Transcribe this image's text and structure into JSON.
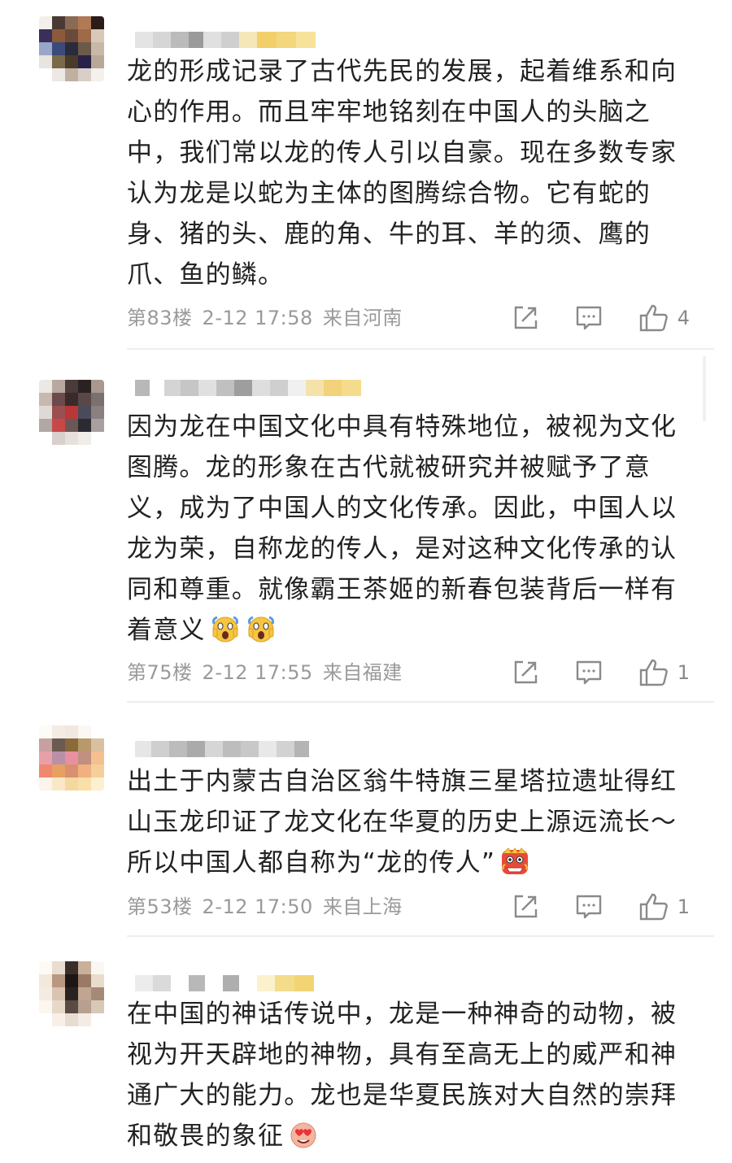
{
  "comments": [
    {
      "text": "龙的形成记录了古代先民的发展，起着维系和向心的作用。而且牢牢地铭刻在中国人的头脑之中，我们常以龙的传人引以自豪。现在多数专家认为龙是以蛇为主体的图腾综合物。它有蛇的身、猪的头、鹿的角、牛的耳、羊的须、鹰的爪、鱼的鳞。",
      "floor": "第83楼",
      "time": "2-12 17:58",
      "location": "来自河南",
      "likes": "4",
      "avatar_colors": [
        "#f3efea",
        "#4a3a33",
        "#8b6a55",
        "#b07a55",
        "#2a1c18",
        "#3a2f5a",
        "#8a5a3a",
        "#6a4a3a",
        "#a06a48",
        "#d8c8b8",
        "#9aa6c8",
        "#3a4a7a",
        "#2a2a3a",
        "#6a5a4a",
        "#c8b8a8",
        "#e8e4e0",
        "#7a6a4a",
        "#4a3a2a",
        "#28224a",
        "#b8a898",
        "#ffffff",
        "#ece8e4",
        "#c0b0a0",
        "#d8d0c8",
        "#f4f0ec"
      ],
      "name_blocks": [
        {
          "w": 22,
          "c": "#e4e4e4"
        },
        {
          "w": 22,
          "c": "#d6d6d6"
        },
        {
          "w": 22,
          "c": "#bbbbbb"
        },
        {
          "w": 18,
          "c": "#9a9a9a"
        },
        {
          "w": 22,
          "c": "#e0e0e0"
        },
        {
          "w": 22,
          "c": "#cfcfcf"
        },
        {
          "w": 22,
          "c": "#f6e7b8"
        },
        {
          "w": 24,
          "c": "#f2cf6a"
        },
        {
          "w": 24,
          "c": "#f4d67c"
        },
        {
          "w": 24,
          "c": "#f6e29a"
        }
      ]
    },
    {
      "text": "因为龙在中国文化中具有特殊地位，被视为文化图腾。龙的形象在古代就被研究并被赋予了意义，成为了中国人的文化传承。因此，中国人以龙为荣，自称龙的传人，是对这种文化传承的认同和尊重。就像霸王茶姬的新春包装背后一样有着意义",
      "floor": "第75楼",
      "time": "2-12 17:55",
      "location": "来自福建",
      "likes": "1",
      "emojis": [
        "scream-emoji",
        "scream-emoji"
      ],
      "avatar_colors": [
        "#ece8e4",
        "#b8a8a0",
        "#4a3a3a",
        "#2a2222",
        "#a89890",
        "#c8b8b0",
        "#6a4a4a",
        "#3a2a2a",
        "#5a4848",
        "#7a7070",
        "#e0d8d4",
        "#9a5050",
        "#b83838",
        "#4a4a5a",
        "#8a8080",
        "#b0a8a4",
        "#c84848",
        "#6a5858",
        "#2a2a30",
        "#a8a0a0",
        "#ffffff",
        "#d8d0cc",
        "#e8e0dc",
        "#f0ece8",
        "#ffffff"
      ],
      "name_blocks": [
        {
          "w": 18,
          "c": "#b8b8b8"
        },
        {
          "w": 18,
          "c": "#ffffff"
        },
        {
          "w": 20,
          "c": "#d4d4d4"
        },
        {
          "w": 22,
          "c": "#c6c6c6"
        },
        {
          "w": 22,
          "c": "#e0e0e0"
        },
        {
          "w": 22,
          "c": "#c0c0c0"
        },
        {
          "w": 22,
          "c": "#9e9e9e"
        },
        {
          "w": 22,
          "c": "#dedede"
        },
        {
          "w": 22,
          "c": "#cfcfcf"
        },
        {
          "w": 22,
          "c": "#f0f0f0"
        },
        {
          "w": 22,
          "c": "#f5e2a8"
        },
        {
          "w": 22,
          "c": "#f2d27a"
        },
        {
          "w": 24,
          "c": "#f4dc8c"
        }
      ]
    },
    {
      "text": "出土于内蒙古自治区翁牛特旗三星塔拉遗址得红山玉龙印证了龙文化在华夏的历史上源远流长～所以中国人都自称为“龙的传人”",
      "floor": "第53楼",
      "time": "2-12 17:50",
      "location": "来自上海",
      "likes": "1",
      "emojis": [
        "lion-dance-emoji"
      ],
      "avatar_colors": [
        "#fdfbf8",
        "#f4ece4",
        "#f0e8e0",
        "#fbf8f4",
        "#ffffff",
        "#c8a0a0",
        "#6a5a50",
        "#8a6a3a",
        "#b89a6a",
        "#d8c0a0",
        "#e8a0a8",
        "#b890a8",
        "#e890a0",
        "#c09080",
        "#f4c090",
        "#f08870",
        "#e8a060",
        "#d89070",
        "#f0b080",
        "#f4d098",
        "#fbf4ea",
        "#f8e8c8",
        "#f4d8a0",
        "#f8e0a8",
        "#fcf0d0"
      ],
      "name_blocks": [
        {
          "w": 20,
          "c": "#e6e6e6"
        },
        {
          "w": 22,
          "c": "#cfcfcf"
        },
        {
          "w": 22,
          "c": "#bcbcbc"
        },
        {
          "w": 22,
          "c": "#aaaaaa"
        },
        {
          "w": 22,
          "c": "#d6d6d6"
        },
        {
          "w": 22,
          "c": "#bdbdbd"
        },
        {
          "w": 22,
          "c": "#c8c8c8"
        },
        {
          "w": 22,
          "c": "#e8e8e8"
        },
        {
          "w": 22,
          "c": "#d2d2d2"
        },
        {
          "w": 18,
          "c": "#b4b4b4"
        }
      ]
    },
    {
      "text": "在中国的神话传说中，龙是一种神奇的动物，被视为开天辟地的神物，具有至高无上的威严和神通广大的能力。龙也是华夏民族对大自然的崇拜和敬畏的象征",
      "floor": "",
      "time": "",
      "location": "",
      "likes": "",
      "emojis": [
        "heart-eyes-emoji"
      ],
      "avatar_colors": [
        "#fdfaf6",
        "#e8ddd0",
        "#3a2e2a",
        "#c8b09a",
        "#faf6f2",
        "#f2e8dc",
        "#b89880",
        "#1e1614",
        "#9a7a66",
        "#e8dccc",
        "#f4ece2",
        "#d8c4b0",
        "#2a2220",
        "#c0a690",
        "#a68a78",
        "#fbf6f0",
        "#e8d8c8",
        "#5a4a44",
        "#b8a090",
        "#d8c8b8",
        "#ffffff",
        "#f8f0e8",
        "#e8dcd0",
        "#f4ece4",
        "#ffffff"
      ],
      "name_blocks": [
        {
          "w": 22,
          "c": "#ececec"
        },
        {
          "w": 22,
          "c": "#dadada"
        },
        {
          "w": 22,
          "c": "#ffffff"
        },
        {
          "w": 20,
          "c": "#b8b8b8"
        },
        {
          "w": 22,
          "c": "#ffffff"
        },
        {
          "w": 20,
          "c": "#aeaeae"
        },
        {
          "w": 22,
          "c": "#ffffff"
        },
        {
          "w": 22,
          "c": "#fbf1cc"
        },
        {
          "w": 24,
          "c": "#f4dc8a"
        },
        {
          "w": 24,
          "c": "#f2d474"
        }
      ]
    }
  ]
}
